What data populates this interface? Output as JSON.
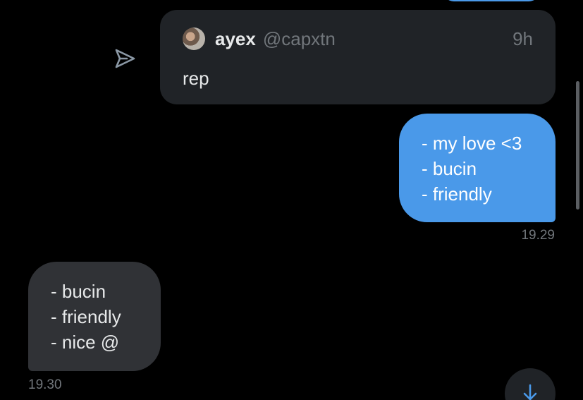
{
  "quoted_post": {
    "name": "ayex",
    "handle": "@capxtn",
    "time": "9h",
    "text": "rep"
  },
  "messages": [
    {
      "direction": "outgoing",
      "lines": [
        "- my love <3",
        "- bucin",
        "- friendly"
      ],
      "time": "19.29"
    },
    {
      "direction": "incoming",
      "lines": [
        "- bucin",
        "- friendly",
        "- nice @"
      ],
      "time": "19.30"
    }
  ],
  "icons": {
    "share": "send-icon",
    "scroll": "arrow-down-icon",
    "avatar": "user-avatar"
  },
  "colors": {
    "background": "#000000",
    "outgoing_bubble": "#4a99e9",
    "incoming_bubble": "#303236",
    "card": "#202327",
    "secondary_text": "#71767b"
  }
}
